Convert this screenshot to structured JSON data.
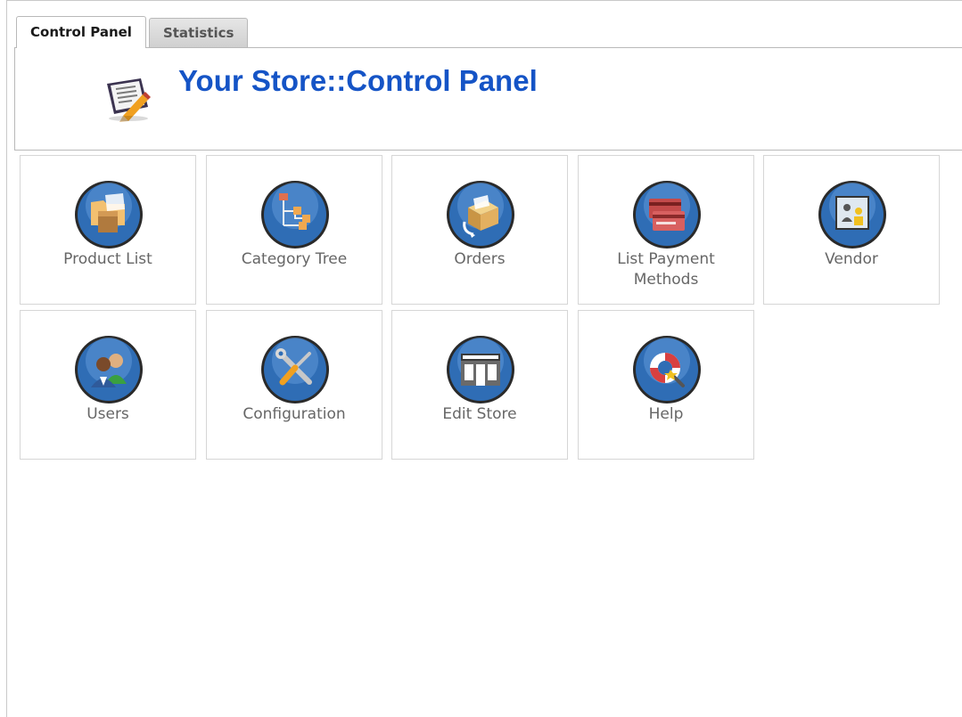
{
  "tabs": [
    {
      "label": "Control Panel",
      "active": true
    },
    {
      "label": "Statistics",
      "active": false
    }
  ],
  "header": {
    "title": "Your Store::Control Panel",
    "icon": "store-control-panel-icon"
  },
  "tiles": {
    "product_list": {
      "label": "Product List",
      "icon": "product-folder-box-icon"
    },
    "category_tree": {
      "label": "Category Tree",
      "icon": "category-tree-icon"
    },
    "orders": {
      "label": "Orders",
      "icon": "orders-box-icon"
    },
    "list_payment_methods": {
      "label": "List Payment Methods",
      "icon": "credit-cards-icon"
    },
    "vendor": {
      "label": "Vendor",
      "icon": "vendor-icon"
    },
    "users": {
      "label": "Users",
      "icon": "users-icon"
    },
    "configuration": {
      "label": "Configuration",
      "icon": "tools-icon"
    },
    "edit_store": {
      "label": "Edit Store",
      "icon": "storefront-icon"
    },
    "help": {
      "label": "Help",
      "icon": "lifebuoy-icon"
    }
  },
  "colors": {
    "title": "#1554c6",
    "icon_orb": "#2a6fb8",
    "label": "#666666",
    "border": "#d6d6d6"
  }
}
